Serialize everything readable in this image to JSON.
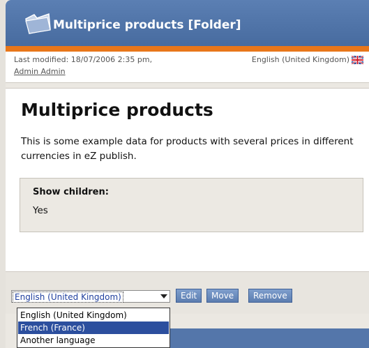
{
  "page": {
    "title": "Multiprice products [Folder]",
    "last_modified": "Last modified: 18/07/2006 2:35 pm,",
    "author": "Admin Admin",
    "language": "English (United Kingdom)"
  },
  "content": {
    "heading": "Multiprice products",
    "description": "This is some example data for products with several prices in different currencies in eZ publish.",
    "show_children_label": "Show children:",
    "show_children_value": "Yes"
  },
  "actions": {
    "language_select": "English (United Kingdom)",
    "edit": "Edit",
    "move": "Move",
    "remove": "Remove"
  },
  "language_options": [
    "English (United Kingdom)",
    "French (France)",
    "Another language"
  ],
  "colors": {
    "accent_orange": "#e8761a",
    "header_blue": "#5476aa"
  }
}
